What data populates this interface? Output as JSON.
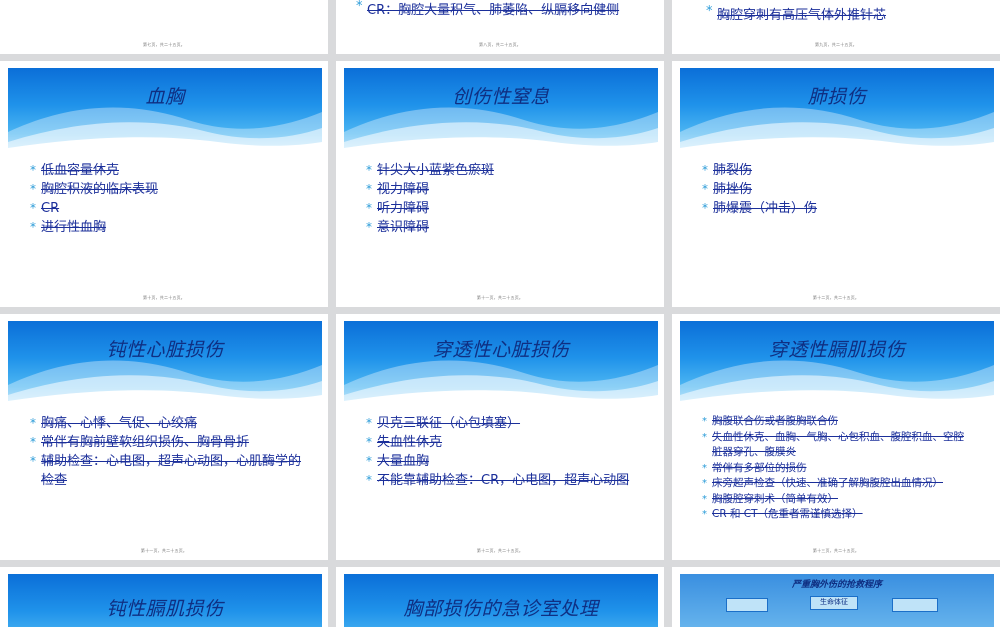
{
  "row0": [
    {
      "footer": "第七页，共二十五页。"
    },
    {
      "bullet": "CR：胸腔大量积气、肺萎陷、纵膈移向健侧",
      "footer": "第八页，共二十五页。"
    },
    {
      "bullet": "胸腔穿刺有高压气体外推针芯",
      "footer": "第九页，共二十五页。"
    }
  ],
  "slides": [
    {
      "title": "血胸",
      "bullets": [
        "低血容量休克",
        "胸腔积液的临床表现",
        "CR",
        "进行性血胸"
      ],
      "footer": "第十页，共二十五页。"
    },
    {
      "title": "创伤性窒息",
      "bullets": [
        "针尖大小蓝紫色瘀斑",
        "视力障碍",
        "听力障碍",
        "意识障碍"
      ],
      "footer": "第十一页，共二十五页。"
    },
    {
      "title": "肺损伤",
      "bullets": [
        "肺裂伤",
        "肺挫伤",
        "肺爆震（冲击）伤"
      ],
      "footer": "第十二页，共二十五页。"
    },
    {
      "title": "钝性心脏损伤",
      "bullets": [
        "胸痛、心悸、气促、心绞痛",
        "常伴有胸前壁软组织损伤、胸骨骨折",
        "辅助检查：心电图，超声心动图，心肌酶学的检查"
      ],
      "footer": "第十一页，共二十五页。"
    },
    {
      "title": "穿透性心脏损伤",
      "bullets": [
        "贝克三联征（心包填塞）",
        "失血性休克",
        "大量血胸",
        "不能靠辅助检查：CR，心电图，超声心动图"
      ],
      "footer": "第十二页，共二十五页。"
    },
    {
      "title": "穿透性膈肌损伤",
      "bullets": [
        "胸腹联合伤或者腹胸联合伤",
        "失血性休克、血胸、气胸、心包积血、腹腔积血、空腔脏器穿孔、腹膜炎",
        "常伴有多部位的损伤",
        "床旁超声检查（快速、准确了解胸腹腔出血情况）",
        "胸腹腔穿刺术（简单有效）",
        "CR 和 CT（危重者需谨慎选择）"
      ],
      "footer": "第十三页，共二十五页。"
    }
  ],
  "row3": [
    {
      "title": "钝性膈肌损伤"
    },
    {
      "title": "胸部损伤的急诊室处理"
    },
    {
      "title": "严重胸外伤的抢救程序",
      "box": "生命体征"
    }
  ]
}
